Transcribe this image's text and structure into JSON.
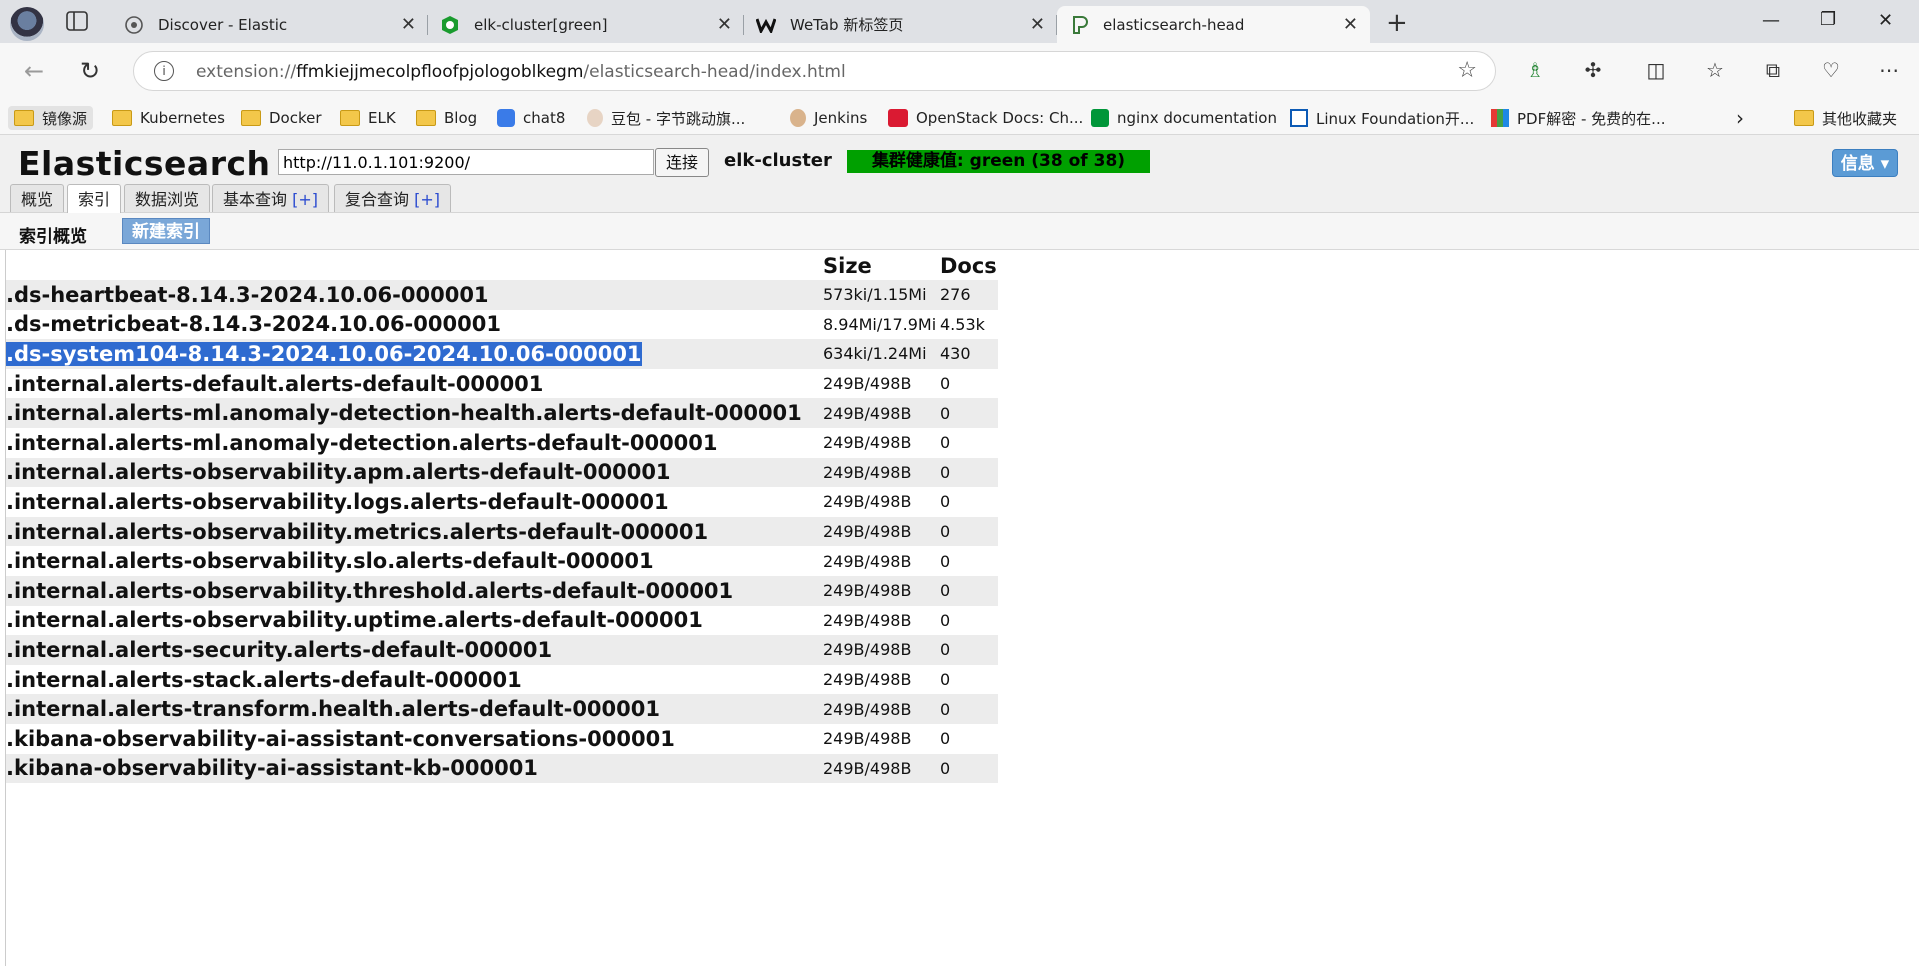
{
  "browser": {
    "tabs": [
      {
        "title": "Discover - Elastic",
        "active": false
      },
      {
        "title": "elk-cluster[green]",
        "active": false
      },
      {
        "title": "WeTab 新标签页",
        "active": false
      },
      {
        "title": "elasticsearch-head",
        "active": true
      }
    ],
    "address": {
      "scheme": "extension://",
      "host": "ffmkiejjmecolpfloofpjologoblkegm",
      "path": "/elasticsearch-head/index.html"
    },
    "bookmarks": [
      {
        "label": "镜像源",
        "icon": "folder-icon"
      },
      {
        "label": "Kubernetes",
        "icon": "folder-icon"
      },
      {
        "label": "Docker",
        "icon": "folder-icon"
      },
      {
        "label": "ELK",
        "icon": "folder-icon"
      },
      {
        "label": "Blog",
        "icon": "folder-icon"
      },
      {
        "label": "chat8",
        "icon": "chat-icon"
      },
      {
        "label": "豆包 - 字节跳动旗...",
        "icon": "doubao-icon"
      },
      {
        "label": "Jenkins",
        "icon": "jenkins-icon"
      },
      {
        "label": "OpenStack Docs: Ch...",
        "icon": "openstack-icon"
      },
      {
        "label": "nginx documentation",
        "icon": "nginx-icon"
      },
      {
        "label": "Linux Foundation开...",
        "icon": "linux-foundation-icon"
      },
      {
        "label": "PDF解密 - 免费的在...",
        "icon": "pdf-icon"
      }
    ],
    "other_bookmarks": "其他收藏夹"
  },
  "app": {
    "brand": "Elasticsearch",
    "host_value": "http://11.0.1.101:9200/",
    "connect_label": "连接",
    "cluster_name": "elk-cluster",
    "health": "集群健康值: green (38 of 38)",
    "health_color": "#00a000",
    "info_label": "信息 ▾",
    "nav_tabs": [
      {
        "label": "概览",
        "plus": ""
      },
      {
        "label": "索引",
        "plus": ""
      },
      {
        "label": "数据浏览",
        "plus": ""
      },
      {
        "label": "基本查询",
        "plus": "[+]"
      },
      {
        "label": "复合查询",
        "plus": "[+]"
      }
    ],
    "active_tab": "索引",
    "section_title": "索引概览",
    "new_index_label": "新建索引"
  },
  "index_table": {
    "headers": [
      "",
      "Size",
      "Docs"
    ],
    "selected_row": 2,
    "rows": [
      {
        "name": ".ds-heartbeat-8.14.3-2024.10.06-000001",
        "size": "573ki/1.15Mi",
        "docs": "276"
      },
      {
        "name": ".ds-metricbeat-8.14.3-2024.10.06-000001",
        "size": "8.94Mi/17.9Mi",
        "docs": "4.53k"
      },
      {
        "name": ".ds-system104-8.14.3-2024.10.06-2024.10.06-000001",
        "size": "634ki/1.24Mi",
        "docs": "430"
      },
      {
        "name": ".internal.alerts-default.alerts-default-000001",
        "size": "249B/498B",
        "docs": "0"
      },
      {
        "name": ".internal.alerts-ml.anomaly-detection-health.alerts-default-000001",
        "size": "249B/498B",
        "docs": "0"
      },
      {
        "name": ".internal.alerts-ml.anomaly-detection.alerts-default-000001",
        "size": "249B/498B",
        "docs": "0"
      },
      {
        "name": ".internal.alerts-observability.apm.alerts-default-000001",
        "size": "249B/498B",
        "docs": "0"
      },
      {
        "name": ".internal.alerts-observability.logs.alerts-default-000001",
        "size": "249B/498B",
        "docs": "0"
      },
      {
        "name": ".internal.alerts-observability.metrics.alerts-default-000001",
        "size": "249B/498B",
        "docs": "0"
      },
      {
        "name": ".internal.alerts-observability.slo.alerts-default-000001",
        "size": "249B/498B",
        "docs": "0"
      },
      {
        "name": ".internal.alerts-observability.threshold.alerts-default-000001",
        "size": "249B/498B",
        "docs": "0"
      },
      {
        "name": ".internal.alerts-observability.uptime.alerts-default-000001",
        "size": "249B/498B",
        "docs": "0"
      },
      {
        "name": ".internal.alerts-security.alerts-default-000001",
        "size": "249B/498B",
        "docs": "0"
      },
      {
        "name": ".internal.alerts-stack.alerts-default-000001",
        "size": "249B/498B",
        "docs": "0"
      },
      {
        "name": ".internal.alerts-transform.health.alerts-default-000001",
        "size": "249B/498B",
        "docs": "0"
      },
      {
        "name": ".kibana-observability-ai-assistant-conversations-000001",
        "size": "249B/498B",
        "docs": "0"
      },
      {
        "name": ".kibana-observability-ai-assistant-kb-000001",
        "size": "249B/498B",
        "docs": "0"
      }
    ]
  }
}
